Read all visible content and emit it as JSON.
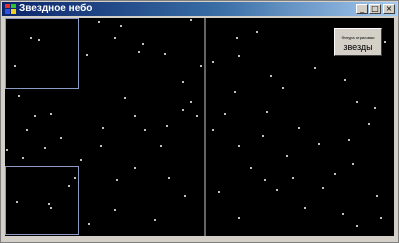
{
  "window": {
    "title": "Звездное небо",
    "caption_buttons": {
      "minimize": "_",
      "maximize": "□",
      "close": "×"
    }
  },
  "button": {
    "line1": "Фигура отрисовки",
    "line2": "звезды"
  },
  "colors": {
    "sky": "#000000",
    "star": "#ffffff",
    "frame": "#8c9bc4",
    "divider": "#c8c8c8"
  },
  "icons": [
    "app-icon"
  ]
}
